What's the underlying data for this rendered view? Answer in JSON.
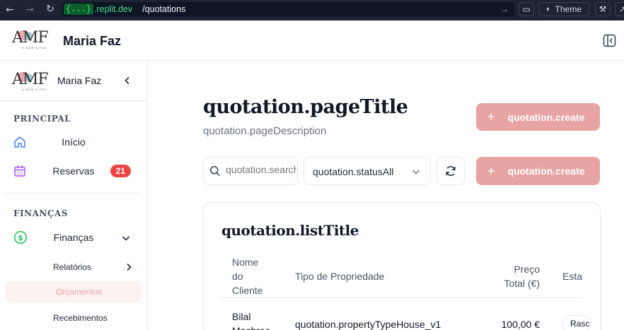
{
  "browser": {
    "dev_badge": "{...}",
    "host": ".replit.dev",
    "path": "/quotations",
    "theme_label": "Theme"
  },
  "topbar": {
    "brand": "Maria Faz",
    "logo_letters": "AMF",
    "logo_tagline": "A MAR A FAZ"
  },
  "sidebar": {
    "brand": "Maria Faz",
    "logo_letters": "AMF",
    "logo_tagline": "A MAR A FAZ",
    "section_principal": "PRINCIPAL",
    "items": [
      {
        "label": "Início"
      },
      {
        "label": "Reservas",
        "count": "21"
      }
    ],
    "section_financas": "FINANÇAS",
    "financas": {
      "label": "Finanças"
    },
    "sub_items": [
      {
        "label": "Relatórios"
      },
      {
        "label": "Orçamentos"
      },
      {
        "label": "Recebimentos"
      }
    ]
  },
  "main": {
    "page_title": "quotation.pageTitle",
    "page_description": "quotation.pageDescription",
    "create_label": "quotation.create",
    "search_placeholder": "quotation.searchPlaceholder",
    "status_filter": "quotation.statusAll",
    "list_title": "quotation.listTitle",
    "table": {
      "headers": [
        "Nome do Cliente",
        "Tipo de Propriedade",
        "Preço Total (€)",
        "Estado"
      ],
      "header_client_lines": [
        "Nome",
        "do",
        "Cliente"
      ],
      "header_price_lines": [
        "Preço",
        "Total (€)"
      ],
      "header_status_visible": "Esta",
      "rows": [
        {
          "client_lines": [
            "Bilal",
            "Machraa"
          ],
          "property_type": "quotation.propertyTypeHouse_v1",
          "price": "100,00 €",
          "status": "Rascunho"
        }
      ]
    }
  },
  "colors": {
    "accent": "#e8a3a3",
    "badge": "#ef4444",
    "active_bg": "#fdf2f2",
    "active_text": "#e8a3a3"
  }
}
